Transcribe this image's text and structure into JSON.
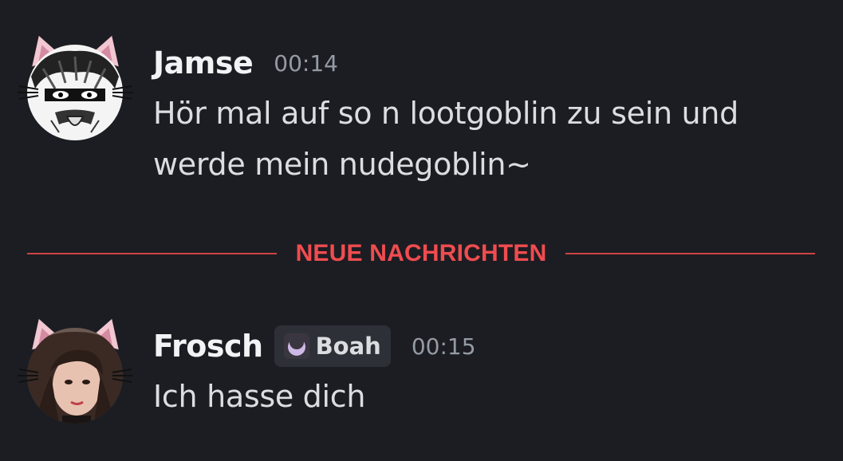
{
  "messages": [
    {
      "username": "Jamse",
      "timestamp": "00:14",
      "lines": [
        "Hör mal auf so n lootgoblin zu sein und",
        "werde mein nudegoblin~"
      ]
    },
    {
      "username": "Frosch",
      "tag": "Boah",
      "timestamp": "00:15",
      "lines": [
        "Ich hasse dich"
      ]
    }
  ],
  "divider": {
    "label": "NEUE NACHRICHTEN",
    "color": "#f04c4f"
  },
  "colors": {
    "background": "#1c1d22",
    "username": "#f2f3f5",
    "text": "#dbdee1",
    "timestamp": "#949ba4",
    "ear_pink": "#f2c7d1"
  },
  "icons": {
    "avatar1": "manga-character-avatar-icon",
    "avatar2": "photo-avatar-icon",
    "tag": "moon-icon"
  }
}
